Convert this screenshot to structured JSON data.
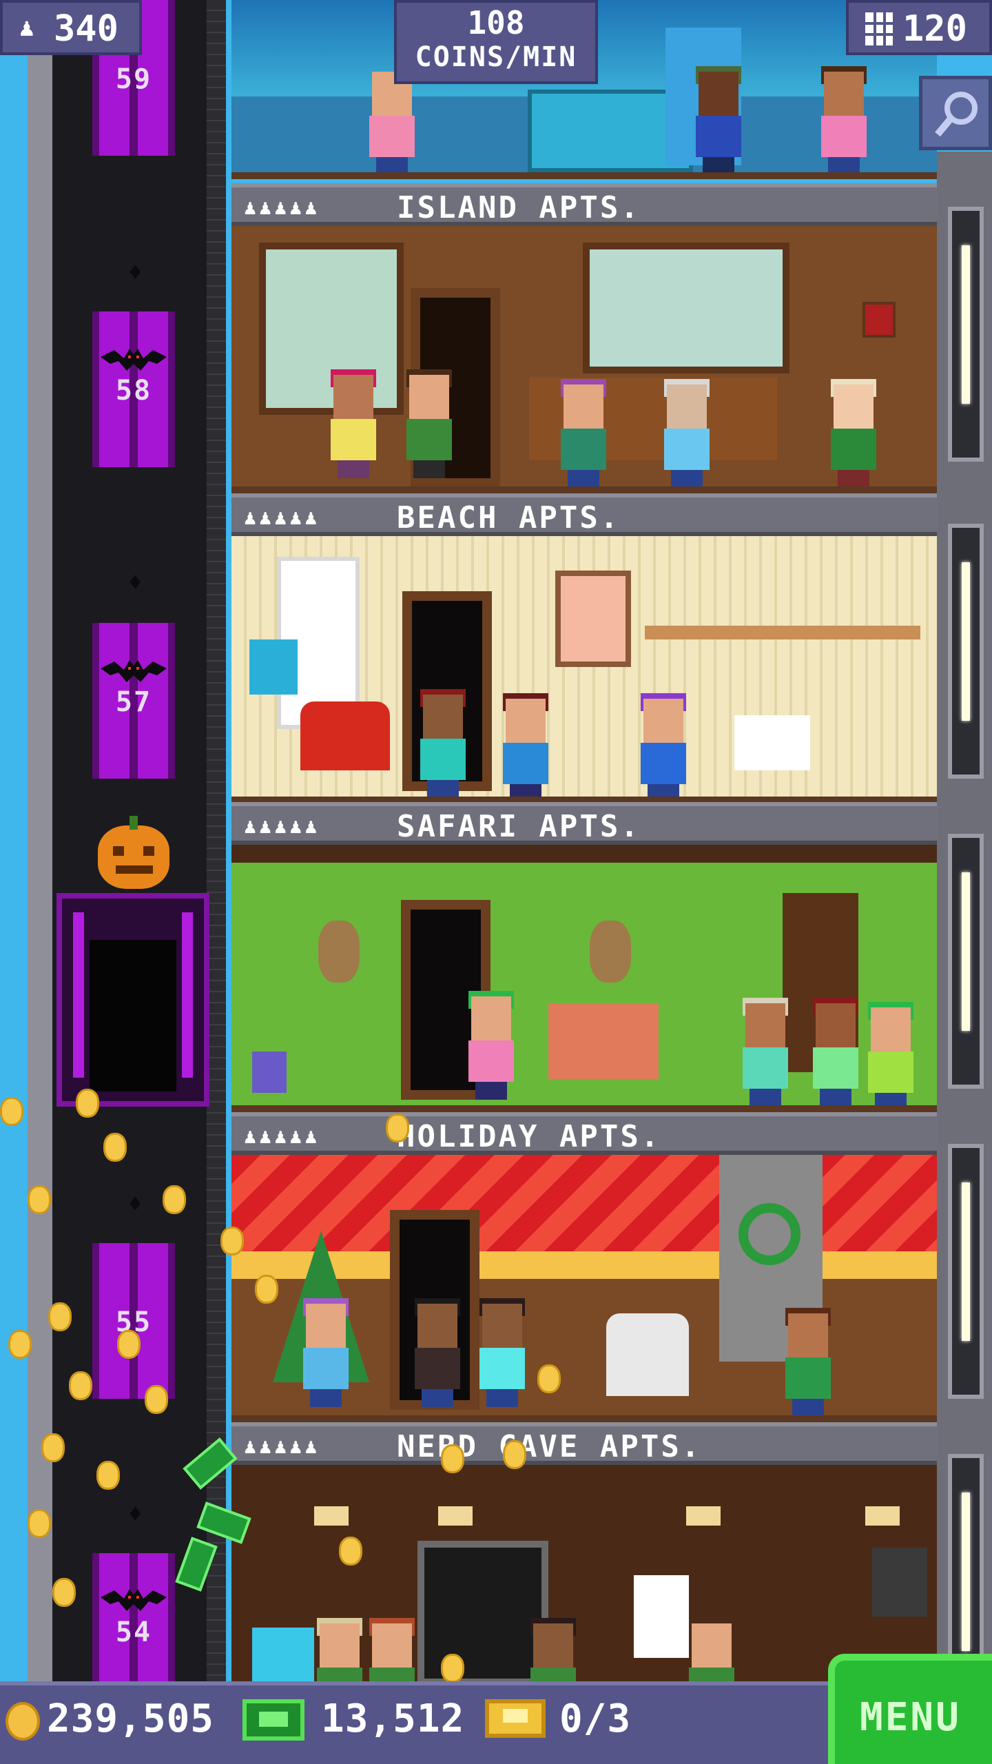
{
  "hud": {
    "population": "340",
    "coins_per_min_value": "108",
    "coins_per_min_label": "COINS/MIN",
    "floor_count": "120"
  },
  "elevator": {
    "floors": [
      "59",
      "58",
      "57",
      "55",
      "54"
    ]
  },
  "floors": [
    {
      "name": "ISLAND APTS.",
      "residents": "♟♟♟♟♟",
      "wall_color": "#7a4b26"
    },
    {
      "name": "BEACH APTS.",
      "residents": "♟♟♟♟♟",
      "wall_color": "#f2e7bf"
    },
    {
      "name": "SAFARI APTS.",
      "residents": "♟♟♟♟♟",
      "wall_color": "#69b83a"
    },
    {
      "name": "HOLIDAY APTS.",
      "residents": "♟♟♟♟♟",
      "wall_color": "#d91e24"
    },
    {
      "name": "NERD CAVE APTS.",
      "residents": "♟♟♟♟♟",
      "wall_color": "#4a2a16"
    }
  ],
  "bottom": {
    "coins": "239,505",
    "bux": "13,512",
    "tickets": "0/3",
    "menu_label": "MENU"
  },
  "colors": {
    "hud_bg": "#55558a",
    "menu_green": "#27bc33",
    "elevator_purple": "#8b0fb0"
  },
  "icons": [
    "population-icon",
    "floors-icon",
    "search-icon",
    "coin-icon",
    "bux-icon",
    "ticket-icon",
    "bat-icon",
    "pumpkin-icon"
  ]
}
